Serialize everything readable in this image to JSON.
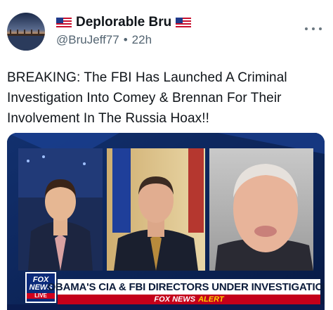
{
  "post": {
    "author": {
      "display_name": "Deplorable Bru",
      "handle": "@BruJeff77",
      "separator": "•",
      "time": "22h",
      "flag_icon": "us-flag-icon"
    },
    "more_icon": "more-horizontal-icon",
    "text": "BREAKING: The FBI Has Launched A Criminal Investigation Into Comey & Brennan For Their Involvement In The Russia Hoax!!",
    "media": {
      "network_logo": {
        "line1": "FOX",
        "line2": "NEWS",
        "line3": "LIVE"
      },
      "chyron": "OBAMA'S CIA & FBI DIRECTORS UNDER INVESTIGATION",
      "alert_bar": {
        "brand": "FOX NEWS",
        "word": "ALERT"
      }
    }
  },
  "colors": {
    "text_primary": "#0f1419",
    "text_secondary": "#536471",
    "fox_blue": "#0b2a7a",
    "fox_red": "#c4001a",
    "alert_yellow": "#ffd400"
  }
}
